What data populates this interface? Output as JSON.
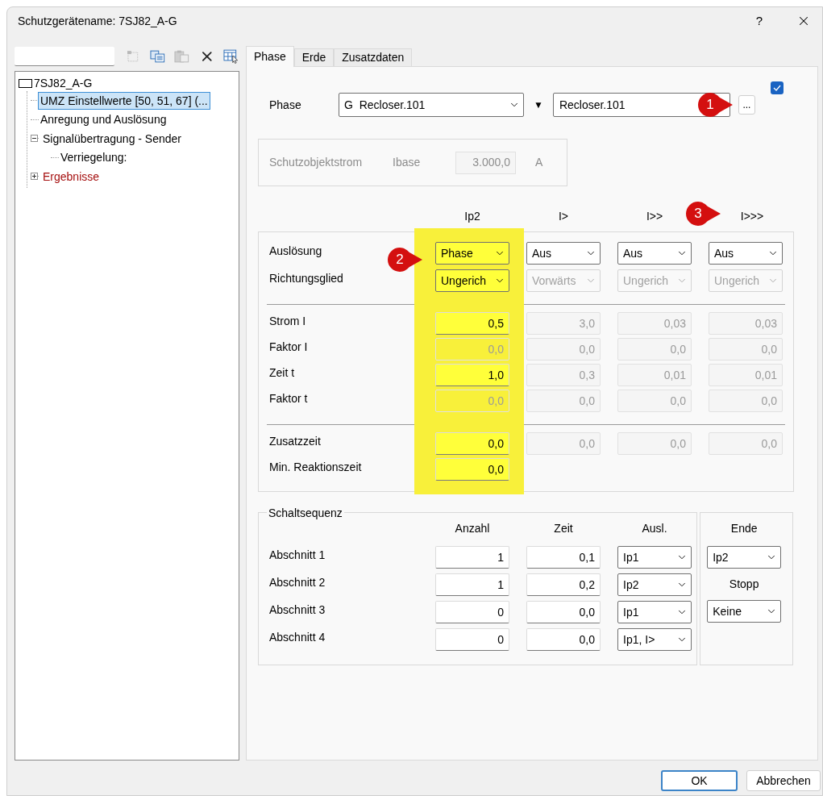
{
  "window": {
    "title": "Schutzgerätename: 7SJ82_A-G",
    "help": "?"
  },
  "tools": [
    {
      "kind": "new",
      "disabled": true
    },
    {
      "kind": "copy",
      "disabled": false
    },
    {
      "kind": "paste",
      "disabled": true
    },
    {
      "kind": "delete",
      "disabled": false
    },
    {
      "kind": "table",
      "disabled": false
    }
  ],
  "tree": {
    "label": "7SJ82_A-G",
    "children": [
      {
        "label": "UMZ Einstellwerte [50, 51, 67] (...",
        "selected": true,
        "color": "#000000"
      },
      {
        "label": "Anregung und Auslösung",
        "selected": false,
        "color": "#000000"
      },
      {
        "label": "Signalübertragung - Sender",
        "selected": false,
        "color": "#000000",
        "expanded": true,
        "children": [
          {
            "label": "Verriegelung:",
            "selected": false,
            "color": "#000000"
          }
        ]
      },
      {
        "label": "Ergebnisse",
        "selected": false,
        "color": "#a50f0f",
        "expanded": false
      }
    ]
  },
  "tabs": [
    {
      "label": "Phase",
      "selected": true
    },
    {
      "label": "Erde",
      "selected": false
    },
    {
      "label": "Zusatzdaten",
      "selected": false
    }
  ],
  "phase_row": {
    "label": "Phase",
    "combo": "G  Recloser.101",
    "filter": "▼",
    "name": "Recloser.101",
    "browse": "...",
    "callout": "1",
    "checked": true
  },
  "base_current": {
    "label": "Schutzobjektstrom",
    "field_label": "Ibase",
    "value": "3.000,0",
    "unit": "A",
    "disabled": true
  },
  "settings": {
    "columns": [
      {
        "label": "Ip2",
        "highlighted": true,
        "callout": "2"
      },
      {
        "label": "I>",
        "highlighted": false
      },
      {
        "label": "I>>",
        "highlighted": false
      },
      {
        "label": "I>>>",
        "highlighted": false,
        "callout": "3"
      }
    ],
    "sections": [
      {
        "rows": [
          {
            "label": "Auslösung",
            "kind": "dropdown",
            "cells": [
              {
                "value": "Phase",
                "disabled": false
              },
              {
                "value": "Aus",
                "disabled": false
              },
              {
                "value": "Aus",
                "disabled": false
              },
              {
                "value": "Aus",
                "disabled": false
              }
            ]
          },
          {
            "label": "Richtungsglied",
            "kind": "dropdown",
            "cells": [
              {
                "value": "Ungerich",
                "disabled": false
              },
              {
                "value": "Vorwärts",
                "disabled": true
              },
              {
                "value": "Ungerich",
                "disabled": true
              },
              {
                "value": "Ungerich",
                "disabled": true
              }
            ]
          }
        ]
      },
      {
        "rows": [
          {
            "label": "Strom I",
            "kind": "number",
            "cells": [
              {
                "value": "0,5",
                "disabled": false
              },
              {
                "value": "3,0",
                "disabled": true
              },
              {
                "value": "0,03",
                "disabled": true
              },
              {
                "value": "0,03",
                "disabled": true
              }
            ]
          },
          {
            "label": "Faktor I",
            "kind": "number",
            "cells": [
              {
                "value": "0,0",
                "disabled": true
              },
              {
                "value": "0,0",
                "disabled": true
              },
              {
                "value": "0,0",
                "disabled": true
              },
              {
                "value": "0,0",
                "disabled": true
              }
            ]
          },
          {
            "label": "Zeit t",
            "kind": "number",
            "cells": [
              {
                "value": "1,0",
                "disabled": false
              },
              {
                "value": "0,3",
                "disabled": true
              },
              {
                "value": "0,01",
                "disabled": true
              },
              {
                "value": "0,01",
                "disabled": true
              }
            ]
          },
          {
            "label": "Faktor t",
            "kind": "number",
            "cells": [
              {
                "value": "0,0",
                "disabled": true
              },
              {
                "value": "0,0",
                "disabled": true
              },
              {
                "value": "0,0",
                "disabled": true
              },
              {
                "value": "0,0",
                "disabled": true
              }
            ]
          }
        ]
      },
      {
        "rows": [
          {
            "label": "Zusatzzeit",
            "kind": "number",
            "cells": [
              {
                "value": "0,0",
                "disabled": false
              },
              {
                "value": "0,0",
                "disabled": true
              },
              {
                "value": "0,0",
                "disabled": true
              },
              {
                "value": "0,0",
                "disabled": true
              }
            ]
          },
          {
            "label": "Min. Reaktionszeit",
            "kind": "number",
            "cells": [
              {
                "value": "0,0",
                "disabled": false
              }
            ]
          }
        ]
      }
    ]
  },
  "sequence": {
    "title": "Schaltsequenz",
    "columns": [
      "Anzahl",
      "Zeit",
      "Ausl."
    ],
    "rows": [
      {
        "label": "Abschnitt 1",
        "count": "1",
        "time": "0,1",
        "trip": "Ip1"
      },
      {
        "label": "Abschnitt 2",
        "count": "1",
        "time": "0,2",
        "trip": "Ip2"
      },
      {
        "label": "Abschnitt 3",
        "count": "0",
        "time": "0,0",
        "trip": "Ip1"
      },
      {
        "label": "Abschnitt 4",
        "count": "0",
        "time": "0,0",
        "trip": "Ip1, I>"
      }
    ]
  },
  "end": {
    "title": "Ende",
    "value": "Ip2",
    "stop_label": "Stopp",
    "stop_value": "Keine"
  },
  "buttons": [
    {
      "label": "OK",
      "default": true
    },
    {
      "label": "Abbrechen",
      "default": false
    }
  ]
}
